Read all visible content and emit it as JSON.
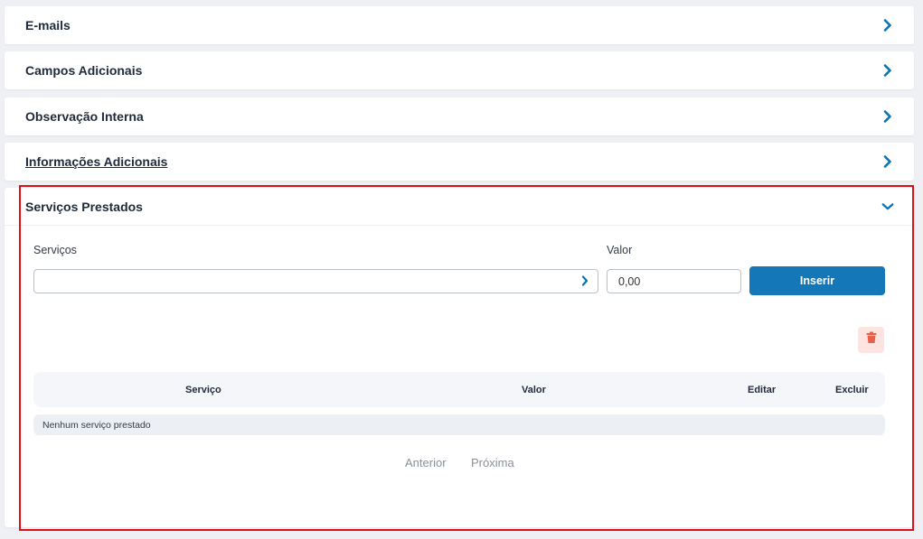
{
  "panels": [
    {
      "title": "E-mails"
    },
    {
      "title": "Campos Adicionais"
    },
    {
      "title": "Observação Interna"
    },
    {
      "title": "Informações Adicionais"
    }
  ],
  "servicos_panel": {
    "title": "Serviços Prestados",
    "servicos_label": "Serviços",
    "servicos_value": "",
    "valor_label": "Valor",
    "valor_value": "0,00",
    "insert_button": "Inserir",
    "table": {
      "columns": [
        "Serviço",
        "Valor",
        "Editar",
        "Excluir"
      ],
      "empty_message": "Nenhum serviço prestado"
    },
    "pagination": {
      "previous": "Anterior",
      "next": "Próxima"
    }
  },
  "colors": {
    "accent": "#1478b8",
    "chevron": "#0a73b5",
    "trash_icon": "#e8604c",
    "trash_bg": "#fde4e1",
    "highlight_border": "#e0101a"
  },
  "icons": {
    "collapsed": "chevron-right-icon",
    "expanded": "chevron-down-icon",
    "select_arrow": "chevron-right-icon",
    "delete": "trash-icon"
  }
}
